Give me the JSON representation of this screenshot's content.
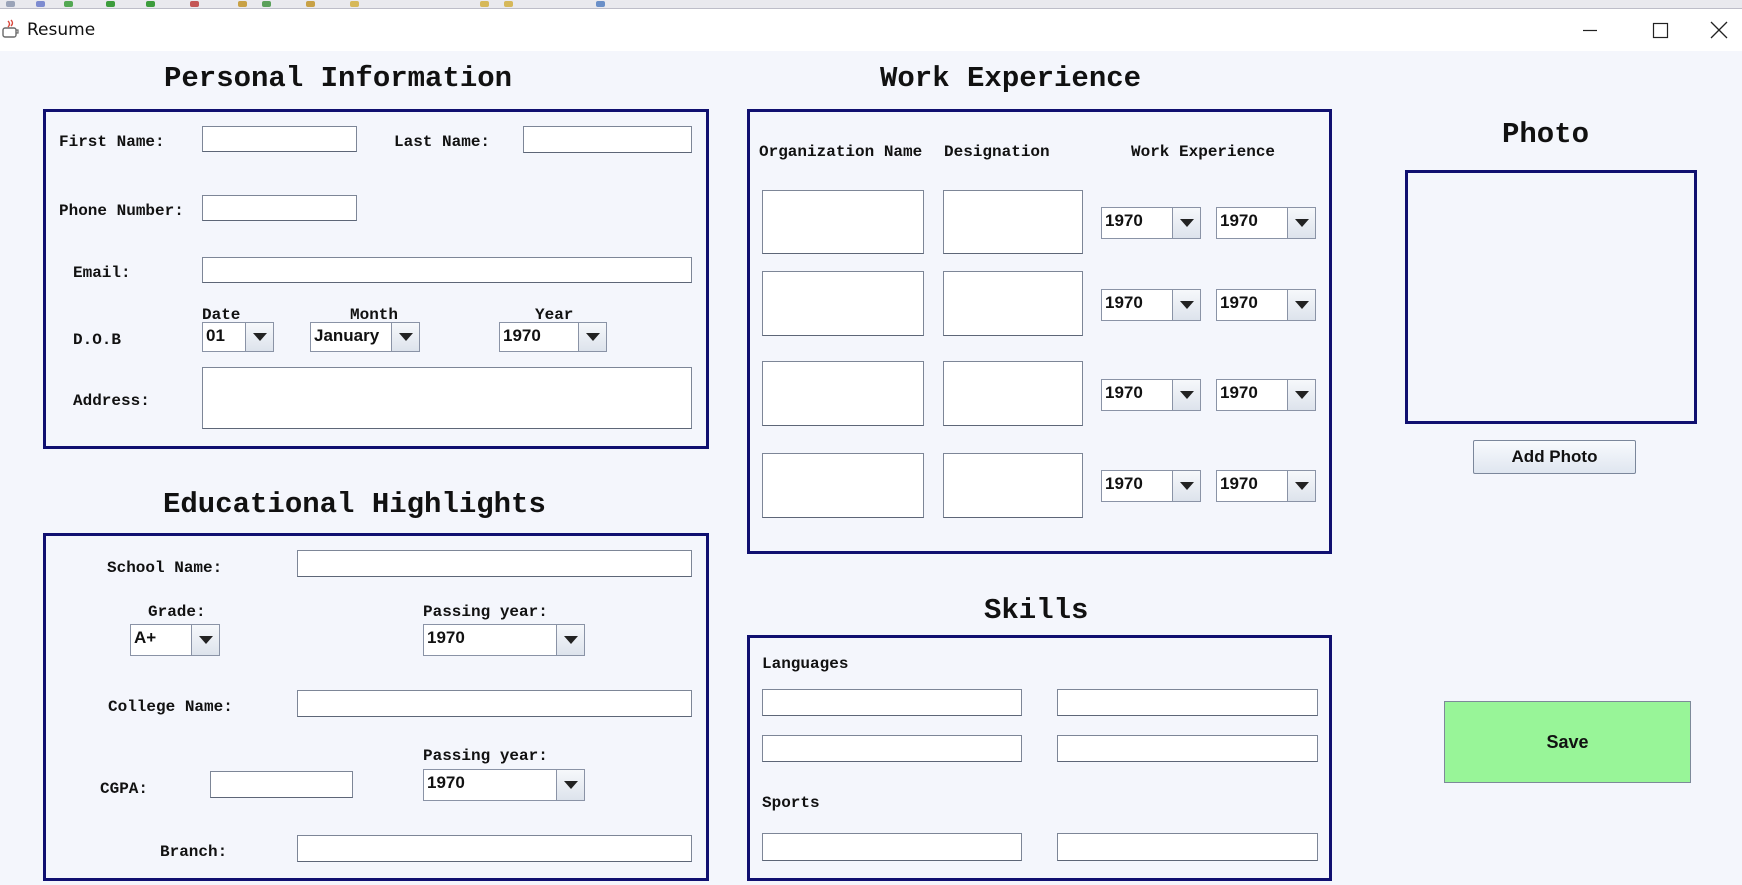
{
  "window": {
    "title": "Resume",
    "minimize_icon": "minimize-icon",
    "maximize_icon": "maximize-icon",
    "close_icon": "close-icon"
  },
  "personal": {
    "heading": "Personal Information",
    "first_name_label": "First Name:",
    "first_name_value": "",
    "last_name_label": "Last Name:",
    "last_name_value": "",
    "phone_label": "Phone Number:",
    "phone_value": "",
    "email_label": "Email:",
    "email_value": "",
    "dob_label": "D.O.B",
    "date_label": "Date",
    "month_label": "Month",
    "year_label": "Year",
    "date_value": "01",
    "month_value": "January",
    "year_value": "1970",
    "address_label": "Address:",
    "address_value": ""
  },
  "education": {
    "heading": "Educational Highlights",
    "school_label": "School Name:",
    "school_value": "",
    "grade_label": "Grade:",
    "grade_value": "A+",
    "school_passing_label": "Passing year:",
    "school_passing_value": "1970",
    "college_label": "College Name:",
    "college_value": "",
    "cgpa_label": "CGPA:",
    "cgpa_value": "",
    "college_passing_label": "Passing year:",
    "college_passing_value": "1970",
    "branch_label": "Branch:",
    "branch_value": ""
  },
  "work": {
    "heading": "Work Experience",
    "col_org": "Organization Name",
    "col_designation": "Designation",
    "col_experience": "Work Experience",
    "rows": [
      {
        "from": "1970",
        "to": "1970"
      },
      {
        "from": "1970",
        "to": "1970"
      },
      {
        "from": "1970",
        "to": "1970"
      },
      {
        "from": "1970",
        "to": "1970"
      }
    ]
  },
  "skills": {
    "heading": "Skills",
    "languages_label": "Languages",
    "sports_label": "Sports"
  },
  "photo": {
    "heading": "Photo",
    "add_button": "Add Photo"
  },
  "save_button": "Save",
  "colors": {
    "panel_border": "#101070",
    "save_bg": "#98f598",
    "background": "#f4f6fc"
  }
}
